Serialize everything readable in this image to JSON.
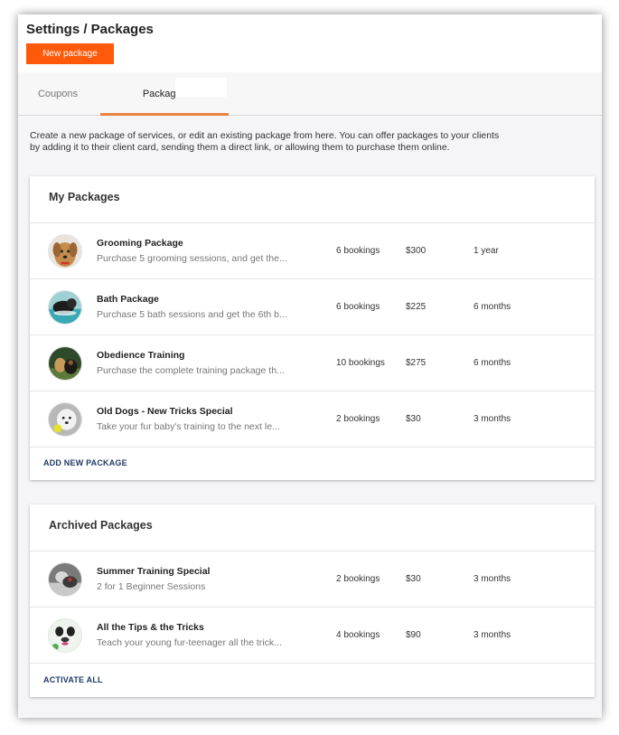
{
  "header": {
    "title": "Settings / Packages",
    "new_package_label": "New package"
  },
  "tabs": [
    {
      "label": "Coupons"
    },
    {
      "label": "Packages"
    }
  ],
  "description": "Create a new package of services, or edit an existing package from here. You can offer packages to your clients by adding it to their client card, sending them a direct link, or allowing them to purchase them online.",
  "my_packages": {
    "title": "My Packages",
    "items": [
      {
        "name": "Grooming Package",
        "desc": "Purchase 5 grooming sessions, and get the...",
        "bookings": "6 bookings",
        "price": "$300",
        "duration": "1 year"
      },
      {
        "name": "Bath Package",
        "desc": "Purchase 5 bath sessions and get the 6th b...",
        "bookings": "6 bookings",
        "price": "$225",
        "duration": "6 months"
      },
      {
        "name": "Obedience Training",
        "desc": "Purchase the complete training package th...",
        "bookings": "10 bookings",
        "price": "$275",
        "duration": "6 months"
      },
      {
        "name": "Old Dogs - New Tricks Special",
        "desc": "Take your fur baby's training to the next le...",
        "bookings": "2 bookings",
        "price": "$30",
        "duration": "3 months"
      }
    ],
    "action_label": "ADD NEW PACKAGE"
  },
  "archived_packages": {
    "title": "Archived Packages",
    "items": [
      {
        "name": "Summer Training Special",
        "desc": "2 for 1 Beginner Sessions",
        "bookings": "2 bookings",
        "price": "$30",
        "duration": "3 months"
      },
      {
        "name": "All the Tips & the Tricks",
        "desc": "Teach your young fur-teenager all the trick...",
        "bookings": "4 bookings",
        "price": "$90",
        "duration": "3 months"
      }
    ],
    "action_label": "ACTIVATE ALL"
  },
  "colors": {
    "accent": "#ff5a0a",
    "tab_underline": "#e8813f",
    "link": "#1f3a66"
  }
}
